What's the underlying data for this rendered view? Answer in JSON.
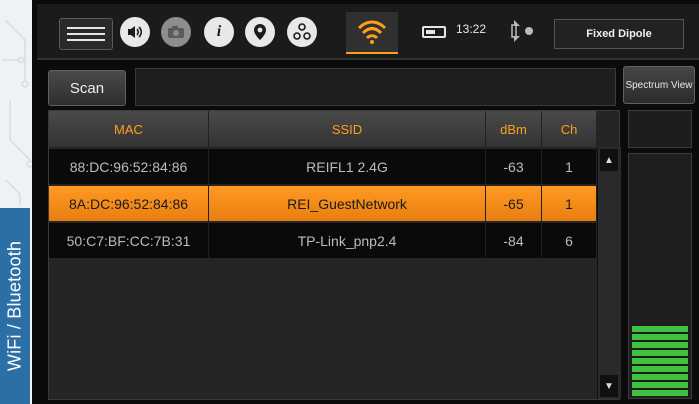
{
  "side_tab": {
    "label": "WiFi / Bluetooth"
  },
  "topbar": {
    "time": "13:22",
    "antenna_label": "Fixed Dipole",
    "icons": [
      "menu-icon",
      "speaker-icon",
      "camera-icon",
      "info-icon",
      "location-pin-icon",
      "network-icon",
      "wifi-icon",
      "battery-icon",
      "gps-icon"
    ],
    "accent_color": "#ff9e1a"
  },
  "controls": {
    "scan_label": "Scan",
    "scan_field_value": "",
    "spectrum_label": "Spectrum View"
  },
  "table": {
    "headers": {
      "mac": "MAC",
      "ssid": "SSID",
      "dbm": "dBm",
      "ch": "Ch"
    },
    "rows": [
      {
        "mac": "88:DC:96:52:84:86",
        "ssid": "REIFL1 2.4G",
        "dbm": "-63",
        "ch": "1",
        "selected": false
      },
      {
        "mac": "8A:DC:96:52:84:86",
        "ssid": "REI_GuestNetwork",
        "dbm": "-65",
        "ch": "1",
        "selected": true
      },
      {
        "mac": "50:C7:BF:CC:7B:31",
        "ssid": "TP-Link_pnp2.4",
        "dbm": "-84",
        "ch": "6",
        "selected": false
      }
    ]
  },
  "signal_meter": {
    "level": 0.3,
    "color": "#3fc33f"
  }
}
